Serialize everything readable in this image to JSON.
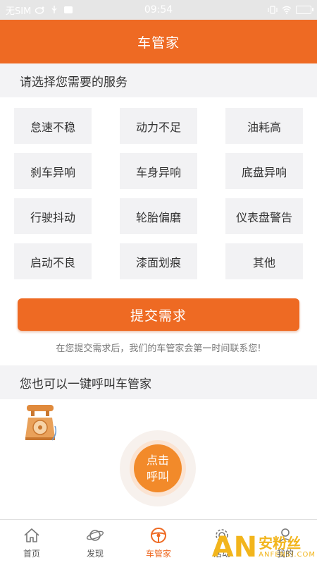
{
  "status_bar": {
    "carrier": "无SIM",
    "time": "09:54"
  },
  "header": {
    "title": "车管家"
  },
  "services": {
    "section_title": "请选择您需要的服务",
    "items": [
      "怠速不稳",
      "动力不足",
      "油耗高",
      "刹车异响",
      "车身异响",
      "底盘异响",
      "行驶抖动",
      "轮胎偏磨",
      "仪表盘警告",
      "启动不良",
      "漆面划痕",
      "其他"
    ],
    "submit_label": "提交需求",
    "hint": "在您提交需求后，我们的车管家会第一时间联系您!"
  },
  "call": {
    "section_title": "您也可以一键呼叫车管家",
    "button_line1": "点击",
    "button_line2": "呼叫"
  },
  "tabbar": {
    "items": [
      {
        "label": "首页",
        "icon": "home-icon"
      },
      {
        "label": "发现",
        "icon": "planet-icon"
      },
      {
        "label": "车管家",
        "icon": "steering-wheel-icon"
      },
      {
        "label": "活动",
        "icon": "gear-icon"
      },
      {
        "label": "我的",
        "icon": "user-icon"
      }
    ],
    "active_index": 2
  },
  "watermark": {
    "logo": "AN",
    "cn": "安粉丝",
    "en": "ANFENSI.COM"
  },
  "colors": {
    "accent": "#ee6a23",
    "call_button": "#f28a2a",
    "watermark": "#f2b51c"
  }
}
